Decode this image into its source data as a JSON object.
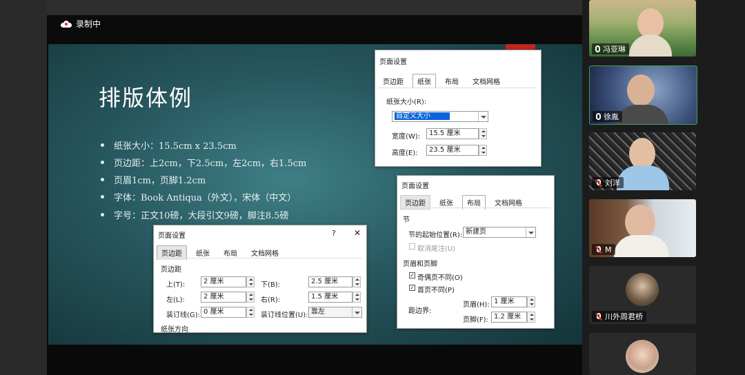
{
  "recording": {
    "label": "录制中"
  },
  "slide": {
    "title": "排版体例",
    "bullets": [
      "纸张大小：15.5cm x 23.5cm",
      "页边距：上2cm，下2.5cm，左2cm，右1.5cm",
      "页眉1cm，页脚1.2cm",
      "字体：Book Antiqua（外文），宋体（中文）",
      "字号：正文10磅，大段引文9磅，脚注8.5磅"
    ]
  },
  "dialog_paper": {
    "title": "页面设置",
    "tabs": [
      "页边距",
      "纸张",
      "布局",
      "文档网格"
    ],
    "paper_size_label": "纸张大小(R):",
    "paper_size_value": "自定义大小",
    "width_label": "宽度(W):",
    "width_value": "15.5 厘米",
    "height_label": "高度(E):",
    "height_value": "23.5 厘米"
  },
  "dialog_layout": {
    "title": "页面设置",
    "tabs": [
      "页边距",
      "纸张",
      "布局",
      "文档网格"
    ],
    "section_label": "节",
    "section_start_label": "节的起始位置(R):",
    "section_start_value": "新建页",
    "suppress_endnotes_label": "取消尾注(U)",
    "header_footer_label": "页眉和页脚",
    "odd_even_label": "奇偶页不同(O)",
    "first_page_label": "首页不同(P)",
    "from_edge_label": "距边界:",
    "header_label": "页眉(H):",
    "header_value": "1 厘米",
    "footer_label": "页脚(F):",
    "footer_value": "1.2 厘米"
  },
  "dialog_margins": {
    "title": "页面设置",
    "help": "?",
    "close": "✕",
    "tabs": [
      "页边距",
      "纸张",
      "布局",
      "文档网格"
    ],
    "margins_label": "页边距",
    "top_label": "上(T):",
    "top_value": "2 厘米",
    "bottom_label": "下(B):",
    "bottom_value": "2.5 厘米",
    "left_label": "左(L):",
    "left_value": "2 厘米",
    "right_label": "右(R):",
    "right_value": "1.5 厘米",
    "gutter_label": "装订线(G):",
    "gutter_value": "0 厘米",
    "gutter_pos_label": "装订线位置(U):",
    "gutter_pos_value": "靠左",
    "orientation_label": "纸张方向"
  },
  "participants": [
    {
      "name": "冯亚琳",
      "mic": "on"
    },
    {
      "name": "徐胤",
      "mic": "on"
    },
    {
      "name": "刘洋",
      "mic": "off"
    },
    {
      "name": "M",
      "mic": "off"
    },
    {
      "name": "川外周君桥",
      "mic": "off"
    },
    {
      "name": "",
      "mic": "none"
    }
  ],
  "colors": {
    "accent_red": "#c0261f",
    "selection_blue": "#0a64d8"
  }
}
